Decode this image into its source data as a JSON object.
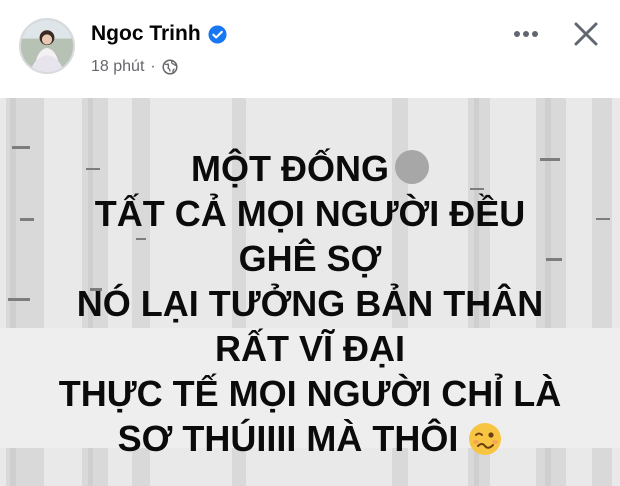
{
  "post": {
    "author": "Ngoc Trinh",
    "verified": true,
    "time": "18 phút",
    "separator": "·",
    "privacy_icon": "globe-icon",
    "lines": [
      "MỘT ĐỐNG",
      "TẤT CẢ MỌI NGƯỜI ĐỀU",
      "GHÊ SỢ",
      "NÓ LẠI TƯỞNG BẢN THÂN",
      "RẤT VĨ ĐẠI",
      "THỰC TẾ MỌI NGƯỜI CHỈ LÀ",
      "SƠ THÚIIII MÀ THÔI"
    ],
    "blurred_object_icon": "blurred-circle",
    "emoji_icon": "woozy-face-emoji"
  },
  "actions": {
    "more_icon": "more-dots-icon",
    "close_icon": "close-icon"
  },
  "colors": {
    "verified_badge": "#1877f2",
    "secondary_text": "#65676b",
    "post_background": "#e9e9e9"
  }
}
